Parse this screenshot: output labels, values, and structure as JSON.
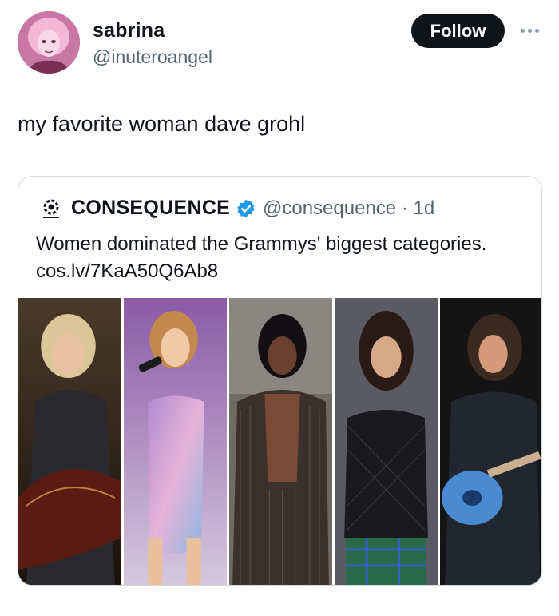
{
  "user": {
    "display_name": "sabrina",
    "handle": "@inuteroangel"
  },
  "follow_label": "Follow",
  "tweet": {
    "text": "my favorite woman dave grohl"
  },
  "quoted": {
    "name": "CONSEQUENCE",
    "handle_time": "@consequence · 1d",
    "text": "Women dominated the Grammys' biggest categories. cos.lv/7KaA50Q6Ab8",
    "photos": [
      {
        "name": "photo-guitarist-1"
      },
      {
        "name": "photo-singer-sparkle"
      },
      {
        "name": "photo-singer-stripes"
      },
      {
        "name": "photo-singer-mesh"
      },
      {
        "name": "photo-guitarist-blue"
      }
    ]
  },
  "colors": {
    "follow_bg": "#0f1419",
    "verified": "#1d9bf0",
    "secondary_text": "#536471",
    "border": "#cfd9de"
  }
}
